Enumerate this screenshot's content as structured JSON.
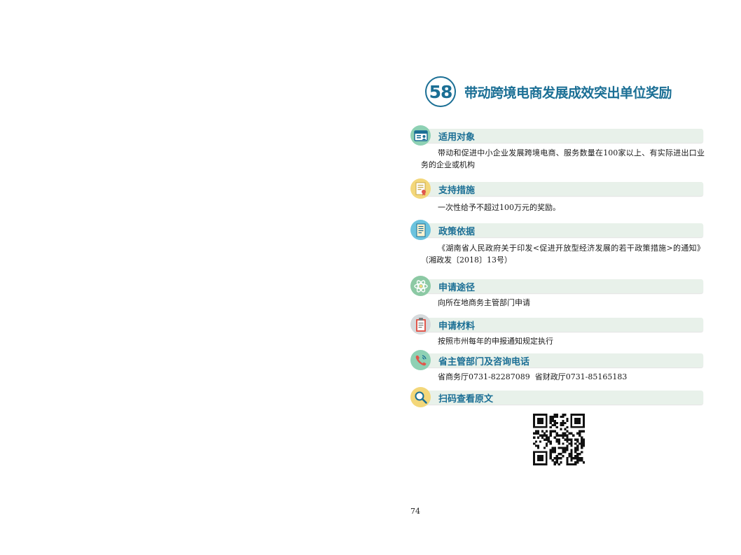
{
  "title": {
    "number": "58",
    "text": "带动跨境电商发展成效突出单位奖励"
  },
  "sections": [
    {
      "title": "适用对象",
      "body": "带动和促进中小企业发展跨境电商、服务数量在100家以上、有实际进出口业务的企业或机构",
      "icon": "id-card-icon",
      "icon_color": "#8ed1b4"
    },
    {
      "title": "支持措施",
      "body": "一次性给予不超过100万元的奖励。",
      "icon": "certificate-icon",
      "icon_color": "#f3d77a"
    },
    {
      "title": "政策依据",
      "body": "《湖南省人民政府关于印发<促进开放型经济发展的若干政策措施>的通知》（湘政发〔2018〕13号）",
      "icon": "document-icon",
      "icon_color": "#6cc3de"
    },
    {
      "title": "申请途径",
      "body": "向所在地商务主管部门申请",
      "icon": "atom-icon",
      "icon_color": "#8cc9a4"
    },
    {
      "title": "申请材料",
      "body": "按照市州每年的申报通知规定执行",
      "icon": "clipboard-icon",
      "icon_color": "#d6dadc"
    },
    {
      "title": "省主管部门及咨询电话",
      "body": "省商务厅0731-82287089  省财政厅0731-85165183",
      "icon": "phone-icon",
      "icon_color": "#8ed1b4"
    },
    {
      "title": "扫码查看原文",
      "body": "",
      "icon": "magnifier-icon",
      "icon_color": "#f3d77a"
    }
  ],
  "qr_code": "qr-code-icon",
  "page_number": "74",
  "colors": {
    "accent": "#1b6f95",
    "bar": "#e8f1ea"
  }
}
